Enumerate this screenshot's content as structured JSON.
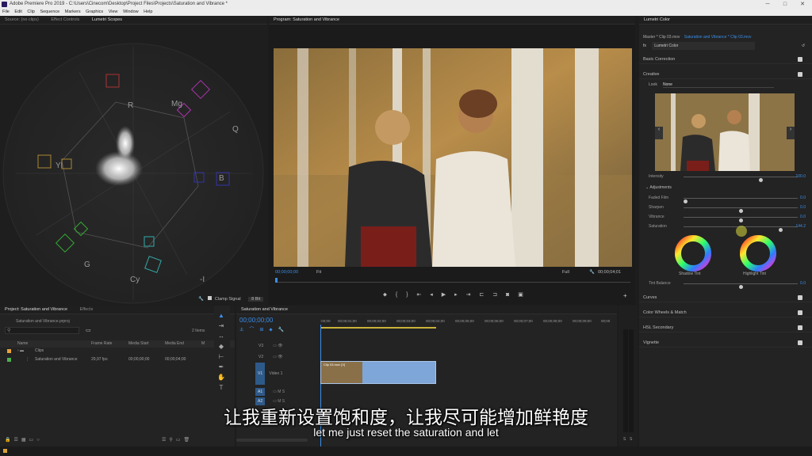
{
  "window": {
    "title": "Adobe Premiere Pro 2019 - C:\\Users\\Cinecom\\Desktop\\Project Files\\Projects\\Saturation and Vibrance *",
    "controls": [
      "─",
      "□",
      "✕"
    ]
  },
  "menu": [
    "File",
    "Edit",
    "Clip",
    "Sequence",
    "Markers",
    "Graphics",
    "View",
    "Window",
    "Help"
  ],
  "source_panel": {
    "tabs": [
      "Source: (no clips)",
      "Effect Controls",
      "Lumetri Scopes"
    ],
    "scope_labels": {
      "R": "R",
      "Mg": "Mg",
      "Q": "Q",
      "Yl": "Yl",
      "B": "B",
      "G": "G",
      "Cy": "Cy",
      "I": "-I"
    },
    "clamp_signal": "Clamp Signal",
    "bit_depth": "8 Bit"
  },
  "program": {
    "tab": "Program: Saturation and Vibrance",
    "timecode_in": "00;00;00;00",
    "fit": "Fit",
    "quality": "Full",
    "timecode_out": "00;00;04;01"
  },
  "lumetri": {
    "tab": "Lumetri Color",
    "master": "Master * Clip 03.mov",
    "clip": "Saturation and Vibrance * Clip 03.mov",
    "fx": "fx",
    "effect": "Lumetri Color",
    "sections": {
      "basic": "Basic Correction",
      "creative": "Creative",
      "curves": "Curves",
      "wheels": "Color Wheels & Match",
      "hsl": "HSL Secondary",
      "vignette": "Vignette"
    },
    "look_label": "Look",
    "look_value": "None",
    "intensity": {
      "label": "Intensity",
      "value": "100.0",
      "level": 0.68
    },
    "adjustments": "Adjustments",
    "sliders": [
      {
        "label": "Faded Film",
        "value": "0.0",
        "level": 0.0
      },
      {
        "label": "Sharpen",
        "value": "0.0",
        "level": 0.5
      },
      {
        "label": "Vibrance",
        "value": "0.0",
        "level": 0.5
      },
      {
        "label": "Saturation",
        "value": "144.2",
        "level": 0.86
      }
    ],
    "shadow_tint": "Shadow Tint",
    "highlight_tint": "Highlight Tint",
    "tint_balance": {
      "label": "Tint Balance",
      "value": "0.0",
      "level": 0.5
    }
  },
  "project": {
    "tabs": [
      "Project: Saturation and Vibrance",
      "Effects"
    ],
    "file": "Saturation and Vibrance.prproj",
    "items_count": "2 Items",
    "columns": [
      "Name",
      "Frame Rate",
      "Media Start",
      "Media End",
      "M"
    ],
    "rows": [
      {
        "name": "Clips",
        "fps": "",
        "start": "",
        "end": "",
        "color": "#e8a23a"
      },
      {
        "name": "Saturation and Vibrance",
        "fps": "29,97 fps",
        "start": "00;00;00;00",
        "end": "00;00;04;00",
        "color": "#4caf50"
      }
    ]
  },
  "timeline": {
    "tab": "Saturation and Vibrance",
    "timecode": "00;00;00;00",
    "ruler": [
      ":00;00",
      "00;00;01;00",
      "00;00;02;00",
      "00;00;03;00",
      "00;00;04;00",
      "00;00;05;00",
      "00;00;06;00",
      "00;00;07;00",
      "00;00;08;00",
      "00;00;09;00",
      "00;00"
    ],
    "tracks": [
      "V3",
      "V2",
      "V1",
      "A1",
      "A2"
    ],
    "v1_name": "Video 1",
    "clip_label": "Clip 03.mov [V]",
    "meter": [
      "S",
      "S"
    ]
  },
  "subtitles": {
    "cn": "让我重新设置饱和度，让我尽可能增加鲜艳度",
    "en": "let me just reset the saturation and let"
  }
}
